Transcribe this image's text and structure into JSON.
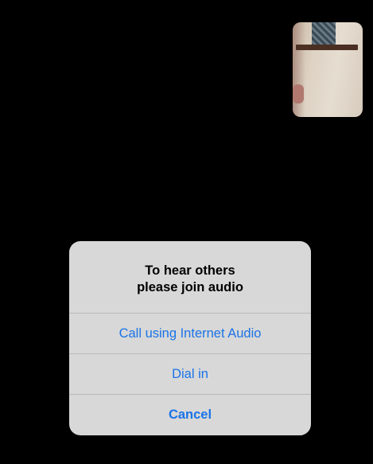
{
  "dialog": {
    "title_line1": "To hear others",
    "title_line2": "please join audio",
    "actions": [
      {
        "label": "Call using Internet Audio"
      },
      {
        "label": "Dial in"
      },
      {
        "label": "Cancel"
      }
    ]
  },
  "colors": {
    "background": "#000000",
    "dialog_bg": "#d8d8d8",
    "action_text": "#1a73e8",
    "title_text": "#000000"
  }
}
